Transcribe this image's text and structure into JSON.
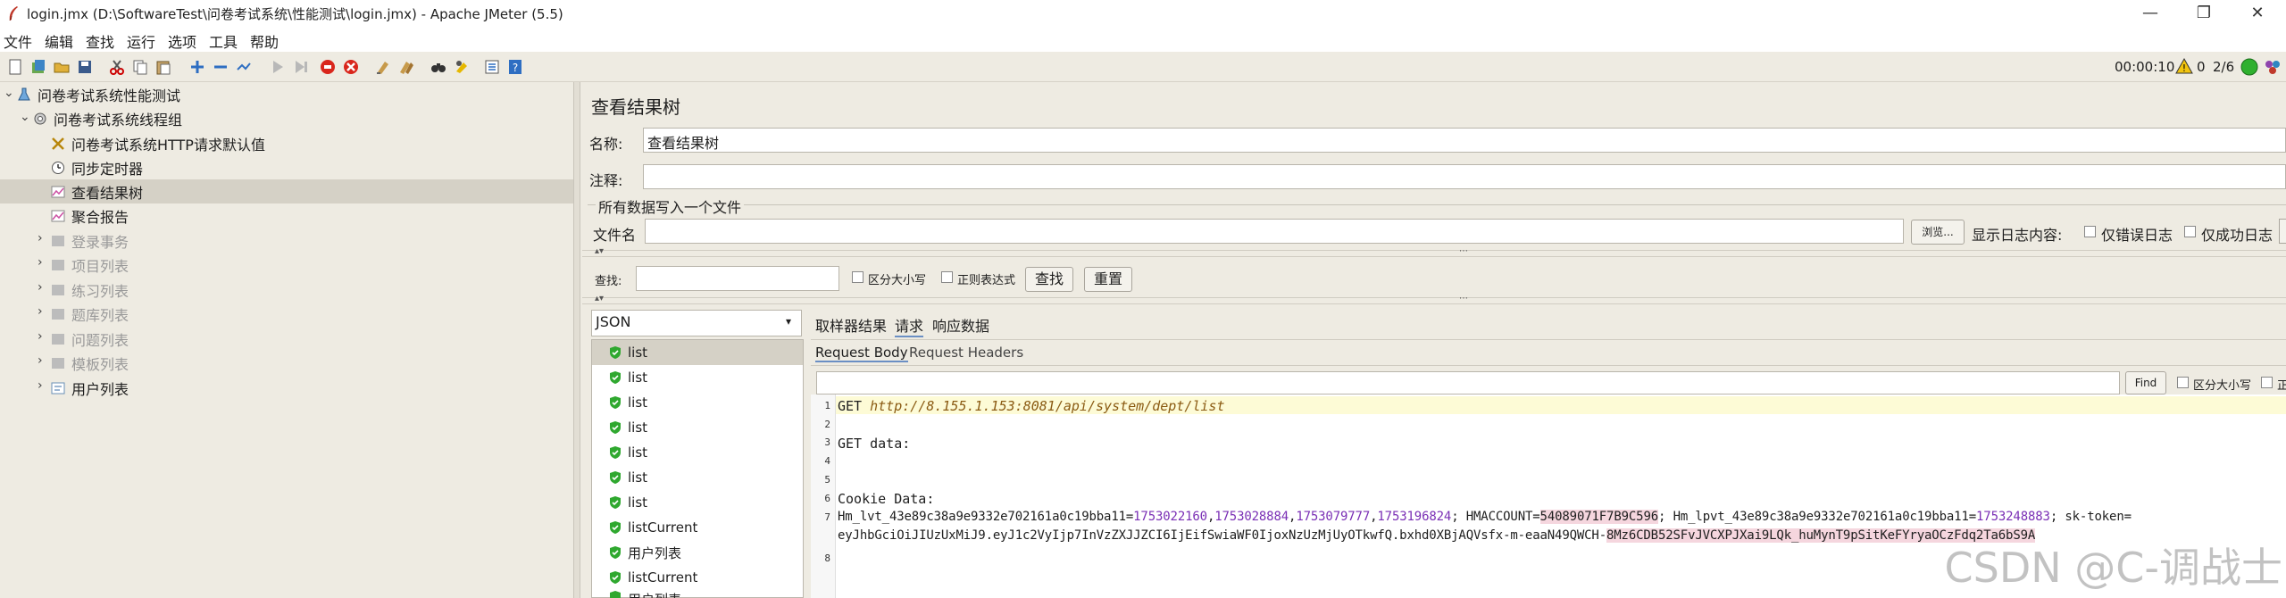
{
  "window": {
    "title": "login.jmx (D:\\SoftwareTest\\问卷考试系统\\性能测试\\login.jmx) - Apache JMeter (5.5)",
    "minimize": "—",
    "restore": "❐",
    "close": "✕"
  },
  "menu": [
    "文件",
    "编辑",
    "查找",
    "运行",
    "选项",
    "工具",
    "帮助"
  ],
  "status": {
    "timer": "00:00:10",
    "warnings": "0",
    "threads": "2/6"
  },
  "tree": {
    "root": "问卷考试系统性能测试",
    "group": "问卷考试系统线程组",
    "items": [
      "问卷考试系统HTTP请求默认值",
      "同步定时器",
      "查看结果树",
      "聚合报告",
      "登录事务",
      "项目列表",
      "练习列表",
      "题库列表",
      "问题列表",
      "模板列表",
      "用户列表"
    ]
  },
  "panel": {
    "title": "查看结果树",
    "name_label": "名称:",
    "name_value": "查看结果树",
    "comment_label": "注释:",
    "section_label": "所有数据写入一个文件",
    "file_label": "文件名",
    "browse": "浏览...",
    "log_label": "显示日志内容:",
    "errors_only": "仅错误日志",
    "success_only": "仅成功日志"
  },
  "search": {
    "label": "查找:",
    "case": "区分大小写",
    "regex": "正则表达式",
    "find": "查找",
    "reset": "重置"
  },
  "renderer": "JSON",
  "results": [
    "list",
    "list",
    "list",
    "list",
    "list",
    "list",
    "list",
    "listCurrent",
    "用户列表",
    "listCurrent",
    "用户列表"
  ],
  "tabs": {
    "sampler": "取样器结果",
    "request": "请求",
    "response": "响应数据",
    "body": "Request Body",
    "headers": "Request Headers"
  },
  "find_bar": {
    "button": "Find",
    "case": "区分大小写",
    "regex": "正"
  },
  "code": {
    "l1_get": "GET ",
    "l1_url": "http://8.155.1.153:8081/api/system/dept/list",
    "l3": "GET data:",
    "l6": "Cookie Data:",
    "l7_a": "Hm_lvt_43e89c38a9e9332e702161a0c19bba11=",
    "l7_n1": "1753022160",
    "l7_n2": "1753028884",
    "l7_n3": "1753079777",
    "l7_n4": "1753196824",
    "l7_b": "; HMACCOUNT=",
    "l7_hm": "54089071F7B9C596",
    "l7_c": "; Hm_lpvt_43e89c38a9e9332e702161a0c19bba11=",
    "l7_n5": "1753248883",
    "l7_d": "; sk-token=",
    "l7_token_a": "eyJhbGciOiJIUzUxMiJ9.eyJ1c2VyIjp7InVzZXJJZCI6IjEifSwiaWF0IjoxNzUzMjUyOTkwfQ.bxhd0XBjAQVsfx-m-eaaN49QWCH-",
    "l7_token_b": "8Mz6CDB52SFvJVCXPJXai9LQk_huMynT9pSitKeFYryaOCzFdq2Ta6bS9A",
    "numbers": [
      "1",
      "2",
      "3",
      "4",
      "5",
      "6",
      "7",
      "",
      "8"
    ]
  },
  "watermark": "CSDN @C-调战士"
}
